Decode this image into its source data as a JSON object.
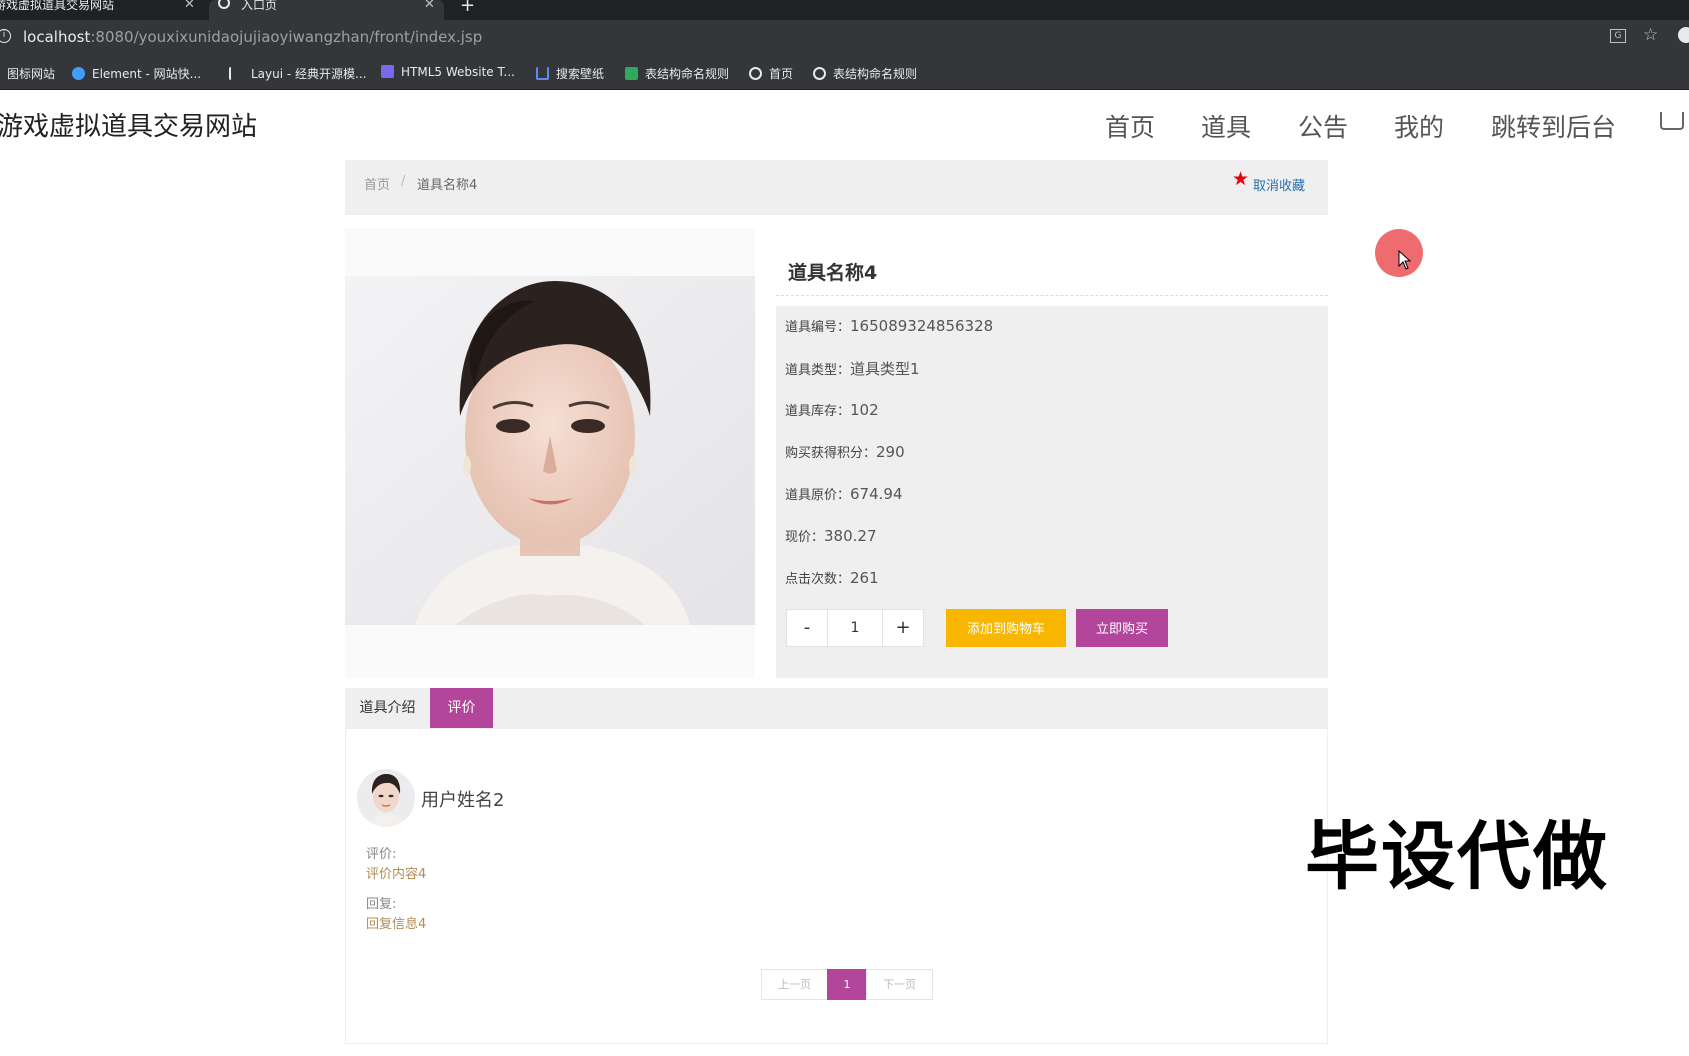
{
  "browser": {
    "tabs": [
      {
        "title": "游戏虚拟道具交易网站",
        "close": "✕"
      },
      {
        "title": "入口页",
        "close": "✕"
      }
    ],
    "new_tab": "+",
    "url_host": "localhost",
    "url_rest": ":8080/youxixunidaojujiaoyiwangzhan/front/index.jsp",
    "bookmarks": [
      "图标网站",
      "Element - 网站快...",
      "Layui - 经典开源模...",
      "HTML5 Website T...",
      "搜索壁纸",
      "表结构命名规则",
      "首页",
      "表结构命名规则"
    ]
  },
  "header": {
    "site_title": "游戏虚拟道具交易网站",
    "nav": [
      "首页",
      "道具",
      "公告",
      "我的",
      "跳转到后台"
    ]
  },
  "breadcrumb": {
    "home": "首页",
    "separator": "/",
    "current": "道具名称4",
    "favorite": "取消收藏"
  },
  "product": {
    "name": "道具名称4",
    "fields": [
      {
        "label": "道具编号：",
        "value": "165089324856328"
      },
      {
        "label": "道具类型：",
        "value": "道具类型1"
      },
      {
        "label": "道具库存：",
        "value": "102"
      },
      {
        "label": "购买获得积分：",
        "value": "290"
      },
      {
        "label": "道具原价：",
        "value": "674.94"
      },
      {
        "label": "现价：",
        "value": "380.27"
      },
      {
        "label": "点击次数：",
        "value": "261"
      }
    ],
    "quantity": "1",
    "minus": "-",
    "plus": "+",
    "add_to_cart": "添加到购物车",
    "buy_now": "立即购买"
  },
  "tabs": {
    "intro": "道具介绍",
    "review": "评价"
  },
  "review": {
    "username": "用户姓名2",
    "comment_label": "评价:",
    "comment": "评价内容4",
    "reply_label": "回复:",
    "reply": "回复信息4"
  },
  "pagination": {
    "prev": "上一页",
    "current": "1",
    "next": "下一页"
  },
  "watermark": "毕设代做",
  "colors": {
    "accent": "#b3469b",
    "cart_button": "#f8b600",
    "favorite_star": "#e60012"
  }
}
